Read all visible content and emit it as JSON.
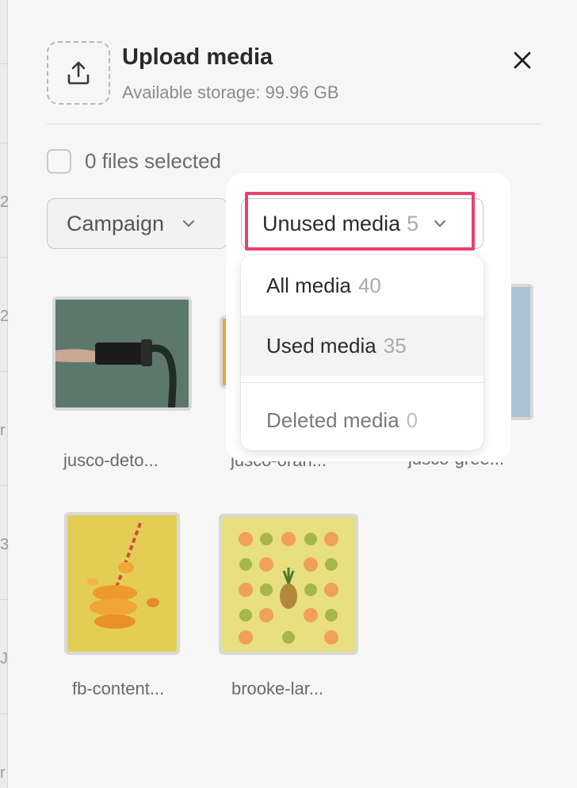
{
  "panel": {
    "title": "Upload media",
    "storage": "Available storage: 99.96 GB",
    "selection_label": "0 files selected"
  },
  "filters": {
    "campaign_label": "Campaign",
    "media_label": "Unused media",
    "media_count": "5"
  },
  "menu": {
    "items": [
      {
        "label": "All media",
        "count": "40"
      },
      {
        "label": "Used media",
        "count": "35"
      },
      {
        "label": "Deleted media",
        "count": "0"
      }
    ]
  },
  "media": [
    {
      "name": "jusco-deto..."
    },
    {
      "name": "jusco-oran..."
    },
    {
      "name": "jusco-gree..."
    },
    {
      "name": "fb-content..."
    },
    {
      "name": "brooke-lar..."
    }
  ],
  "background_page": {
    "edge_chars": [
      "2",
      "2",
      "r",
      "3",
      "Ja",
      "r"
    ]
  },
  "colors": {
    "highlight": "#e8416a",
    "count_gray": "#a9a9a9"
  },
  "icons": [
    "upload-icon",
    "close-icon",
    "chevron-down-icon",
    "kebab-icon"
  ]
}
